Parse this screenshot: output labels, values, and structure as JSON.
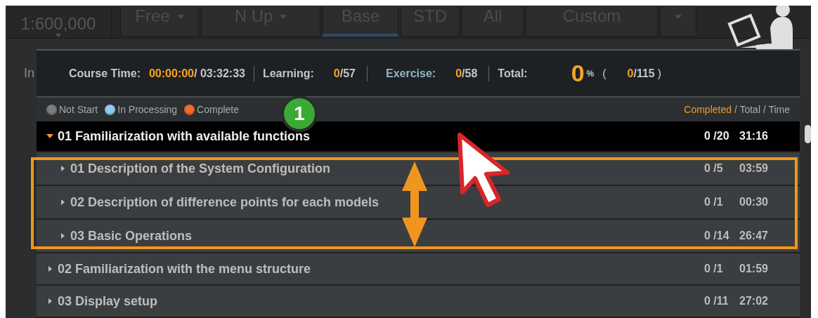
{
  "toolbar": {
    "scale": "1:600,000",
    "items": [
      {
        "label": "Free",
        "kind": "dropdown",
        "selected": false
      },
      {
        "label": "N Up",
        "kind": "dropdown",
        "selected": false
      },
      {
        "label": "Base",
        "kind": "button",
        "selected": true
      },
      {
        "label": "STD",
        "kind": "button",
        "selected": false
      },
      {
        "label": "All",
        "kind": "button",
        "selected": false
      },
      {
        "label": "Custom",
        "kind": "button",
        "selected": false
      },
      {
        "kind": "caret",
        "selected": false
      }
    ],
    "zoom_in": "In"
  },
  "summary": {
    "course_time": {
      "label": "Course Time:",
      "elapsed": "00:00:00",
      "total": "/ 03:32:33"
    },
    "learning": {
      "label": "Learning:",
      "done": "0",
      "total": "/57"
    },
    "exercise": {
      "label": "Exercise:",
      "done": "0",
      "total": "/58"
    },
    "total": {
      "label": "Total:",
      "percent": "0",
      "unit": "%",
      "open": "(",
      "done": "0",
      "total": "/115",
      "close": ")"
    }
  },
  "legend": {
    "items": [
      {
        "label": "Not Start",
        "color": "#7d7d7d"
      },
      {
        "label": "In Processing",
        "color": "#8ccbf0"
      },
      {
        "label": "Complete",
        "color": "#f06a28"
      }
    ],
    "columns": {
      "completed": "Completed",
      "rest": "/ Total / Time"
    }
  },
  "tree": [
    {
      "title": "01 Familiarization with available functions",
      "count": "0 /20",
      "time": "31:16",
      "expanded": true,
      "selected": true,
      "children": [
        {
          "title": "01 Description of the System Configuration",
          "count": "0 /5",
          "time": "03:59",
          "expanded": false,
          "selected": false
        },
        {
          "title": "02 Description of difference points for each models",
          "count": "0 /1",
          "time": "00:30",
          "expanded": false,
          "selected": false
        },
        {
          "title": "03 Basic Operations",
          "count": "0 /14",
          "time": "26:47",
          "expanded": false,
          "selected": false
        }
      ]
    },
    {
      "title": "02 Familiarization with the menu structure",
      "count": "0 /1",
      "time": "01:59",
      "expanded": false,
      "selected": false
    },
    {
      "title": "03 Display setup",
      "count": "0 /11",
      "time": "27:02",
      "expanded": false,
      "selected": false
    }
  ],
  "annotation": {
    "step": "1"
  }
}
